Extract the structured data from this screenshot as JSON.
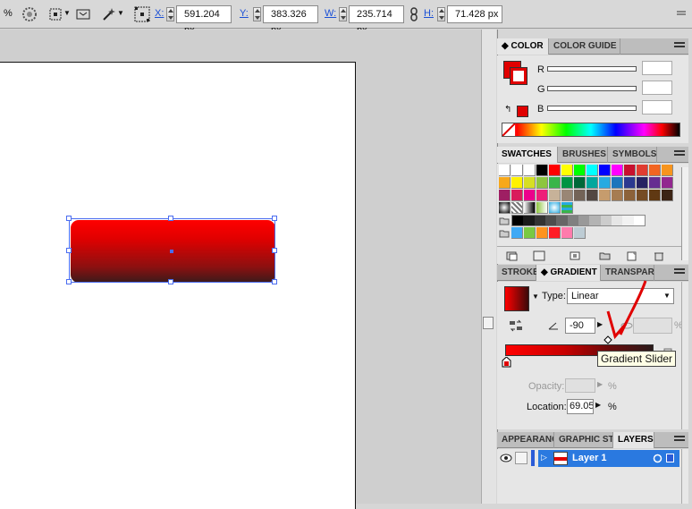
{
  "control_bar": {
    "percent_label": "%",
    "x_label": "X:",
    "x_value": "591.204 px",
    "y_label": "Y:",
    "y_value": "383.326 px",
    "w_label": "W:",
    "w_value": "235.714 px",
    "h_label": "H:",
    "h_value": "71.428 px"
  },
  "color_panel": {
    "tabs": [
      "COLOR",
      "COLOR GUIDE"
    ],
    "r_label": "R",
    "g_label": "G",
    "b_label": "B",
    "fill_color": "#e00000"
  },
  "swatches_panel": {
    "tabs": [
      "SWATCHES",
      "BRUSHES",
      "SYMBOLS"
    ]
  },
  "gradient_panel": {
    "tabs": [
      "STROKE",
      "GRADIENT",
      "TRANSPAR"
    ],
    "type_label": "Type:",
    "type_value": "Linear",
    "angle_value": "-90",
    "aspect_suffix": "%",
    "opacity_label": "Opacity:",
    "opacity_suffix": "%",
    "location_label": "Location:",
    "location_value": "69.05",
    "location_suffix": "%",
    "tooltip": "Gradient Slider"
  },
  "layers_panel": {
    "tabs": [
      "APPEARANCE",
      "GRAPHIC ST",
      "LAYERS"
    ],
    "layer_name": "Layer 1"
  }
}
